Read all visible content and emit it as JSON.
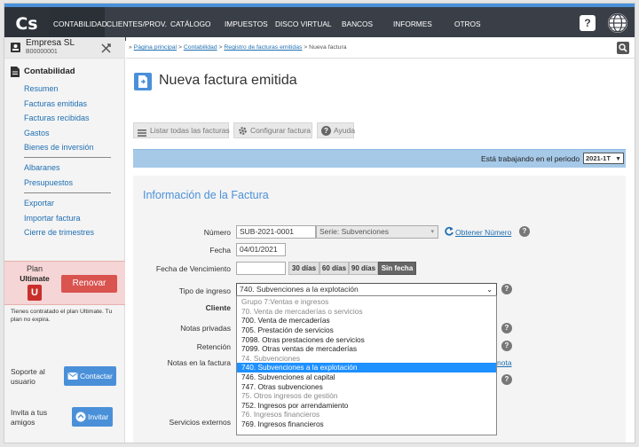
{
  "app": {
    "logo": "Cs"
  },
  "topnav": {
    "items": [
      {
        "label": "CONTABILIDAD",
        "active": true
      },
      {
        "label": "CLIENTES/PROV."
      },
      {
        "label": "CATÁLOGO"
      },
      {
        "label": "IMPUESTOS"
      },
      {
        "label": "DISCO VIRTUAL"
      },
      {
        "label": "BANCOS"
      },
      {
        "label": "INFORMES"
      },
      {
        "label": "OTROS"
      }
    ],
    "help_label": "?"
  },
  "sidebar": {
    "company_name": "Empresa SL",
    "company_id": "B00000001",
    "section_title": "Contabilidad",
    "items": [
      "Resumen",
      "Facturas emitidas",
      "Facturas recibidas",
      "Gastos",
      "Bienes de inversión"
    ],
    "items2": [
      "Albaranes",
      "Presupuestos"
    ],
    "items3": [
      "Exportar",
      "Importar factura",
      "Cierre de trimestres"
    ],
    "plan": {
      "label": "Plan",
      "name": "Ultimate",
      "letter": "U",
      "renew_label": "Renovar",
      "note": "Tienes contratado el plan Ultimate. Tu plan no expira."
    },
    "support": {
      "text": "Soporte al usuario",
      "button": "Contactar"
    },
    "invite": {
      "text": "Invita a tus amigos",
      "button": "Invitar"
    }
  },
  "breadcrumb": {
    "prefix": "»",
    "links": [
      "Página principal",
      "Contabilidad",
      "Registro de facturas emitidas"
    ],
    "separator": ">",
    "current": "Nueva factura"
  },
  "page": {
    "title": "Nueva factura emitida"
  },
  "toolbar": {
    "list_label": "Listar todas las facturas",
    "config_label": "Configurar factura",
    "help_label": "Ayuda"
  },
  "period": {
    "text": "Está trabajando en el periodo",
    "value": "2021-1T"
  },
  "form": {
    "title": "Información de la Factura",
    "numero_label": "Número",
    "numero_value": "SUB-2021-0001",
    "serie_value": "Serie: Subvenciones",
    "obtener_label": "Obtener Número",
    "fecha_label": "Fecha",
    "fecha_value": "04/01/2021",
    "venc_label": "Fecha de Vencimiento",
    "venc_value": "",
    "days": [
      "30 días",
      "60 días",
      "90 días",
      "Sin fecha"
    ],
    "tipo_label": "Tipo de ingreso",
    "tipo_value": "740. Subvenciones a la explotación",
    "cliente_label": "Cliente",
    "notas_privadas_label": "Notas privadas",
    "retencion_label": "Retención",
    "notas_factura_label": "Notas en la factura",
    "notas_factura_link_fragment": "nota",
    "servicios_label": "Servicios externos"
  },
  "dropdown": {
    "options": [
      {
        "label": "Grupo 7:Ventas e ingresos",
        "group": true
      },
      {
        "label": "70. Venta de mercaderías o servicios",
        "group": true
      },
      {
        "label": "700. Venta de mercaderías"
      },
      {
        "label": "705. Prestación de servicios"
      },
      {
        "label": "7098. Otras prestaciones de servicios"
      },
      {
        "label": "7099. Otras ventas de mercaderías"
      },
      {
        "label": "74. Subvenciones",
        "group": true
      },
      {
        "label": "740. Subvenciones a la explotación",
        "selected": true
      },
      {
        "label": "746. Subvenciones al capital"
      },
      {
        "label": "747. Otras subvenciones"
      },
      {
        "label": "75. Otros ingresos de gestión",
        "group": true
      },
      {
        "label": "752. Ingresos por arrendamiento"
      },
      {
        "label": "76. Ingresos financieros",
        "group": true
      },
      {
        "label": "769. Ingresos financieros"
      }
    ]
  },
  "colors": {
    "nav_bg": "#3a3f47",
    "nav_accent": "#4a90d9",
    "link": "#1f6fb2",
    "renew": "#d9534f",
    "action_blue": "#4a90d9",
    "selected_option": "#1e90ff"
  }
}
